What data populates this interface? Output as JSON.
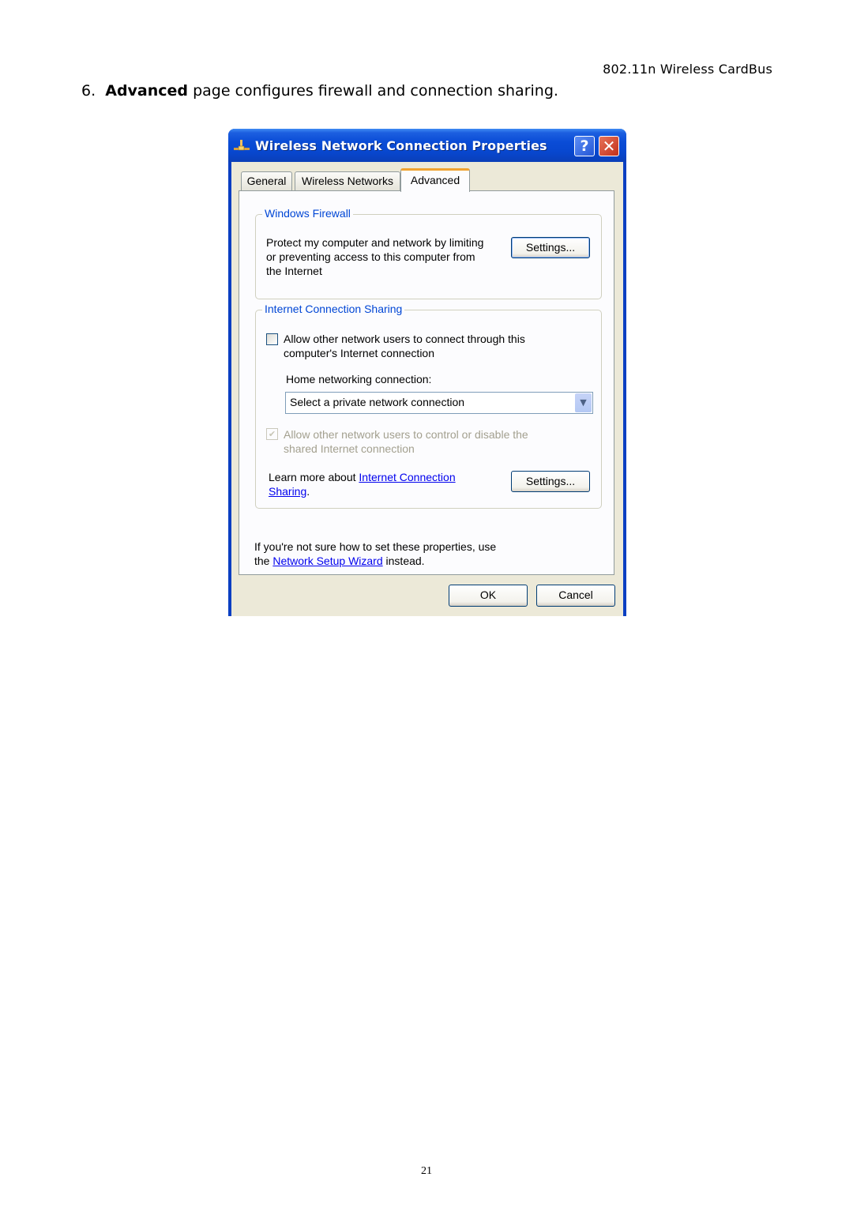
{
  "document": {
    "header": "802.11n Wireless CardBus",
    "step_number": "6.",
    "step_bold": "Advanced",
    "step_rest": " page configures firewall and connection sharing.",
    "page_number": "21"
  },
  "window": {
    "title": "Wireless Network Connection Properties",
    "help_glyph": "?",
    "close_glyph": "✕",
    "tabs": [
      {
        "label": "General",
        "active": false
      },
      {
        "label": "Wireless Networks",
        "active": false
      },
      {
        "label": "Advanced",
        "active": true
      }
    ],
    "firewall": {
      "legend": "Windows Firewall",
      "line1": "Protect my computer and network by limiting",
      "line2": "or preventing access to this computer from",
      "line3": "the Internet",
      "settings_label": "Settings..."
    },
    "ics": {
      "legend": "Internet Connection Sharing",
      "allow_connect_line1": "Allow other network users to connect through this",
      "allow_connect_line2": "computer's Internet connection",
      "allow_connect_checked": false,
      "home_label": "Home networking connection:",
      "home_select_value": "Select a private network connection",
      "allow_control_line1": "Allow other network users to control or disable the",
      "allow_control_line2": "shared Internet connection",
      "allow_control_checked": true,
      "allow_control_disabled": true,
      "learn_prefix": "Learn more about ",
      "learn_link1": "Internet Connection",
      "learn_link2": "Sharing",
      "learn_suffix": ".",
      "settings_label": "Settings..."
    },
    "footer": {
      "line1": "If you're not sure how to set these properties, use",
      "prefix": "the ",
      "link": "Network Setup Wizard",
      "suffix": " instead."
    },
    "ok_label": "OK",
    "cancel_label": "Cancel"
  }
}
